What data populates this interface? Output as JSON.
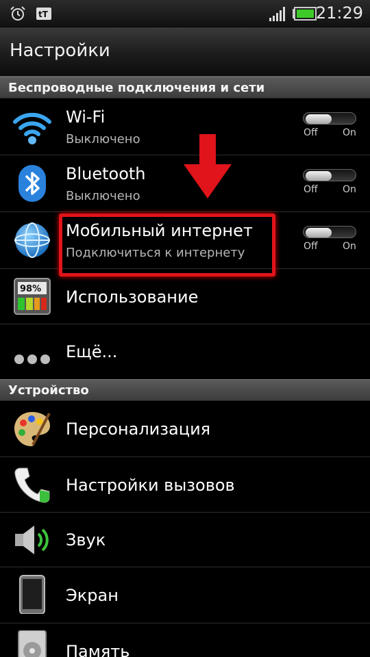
{
  "status_bar": {
    "icons": [
      "alarm-icon",
      "tt-app-icon",
      "signal-icon",
      "battery-icon"
    ],
    "time": "21:29"
  },
  "header": {
    "title": "Настройки"
  },
  "sections": [
    {
      "title": "Беспроводные подключения и сети",
      "items": [
        {
          "label": "Wi-Fi",
          "subtitle": "Выключено",
          "icon": "wifi-icon",
          "toggle": {
            "off": "Off",
            "on": "On",
            "state": "off"
          }
        },
        {
          "label": "Bluetooth",
          "subtitle": "Выключено",
          "icon": "bluetooth-icon",
          "toggle": {
            "off": "Off",
            "on": "On",
            "state": "off"
          }
        },
        {
          "label": "Мобильный интернет",
          "subtitle": "Подключиться к интернету",
          "icon": "globe-icon",
          "toggle": {
            "off": "Off",
            "on": "On",
            "state": "off"
          }
        },
        {
          "label": "Использование",
          "icon": "usage-meter-icon",
          "meter_text": "98%"
        },
        {
          "label": "Ещё...",
          "icon": "more-dots-icon"
        }
      ]
    },
    {
      "title": "Устройство",
      "items": [
        {
          "label": "Персонализация",
          "icon": "palette-icon"
        },
        {
          "label": "Настройки вызовов",
          "icon": "phone-icon"
        },
        {
          "label": "Звук",
          "icon": "speaker-icon"
        },
        {
          "label": "Экран",
          "icon": "screen-icon"
        },
        {
          "label": "Память",
          "icon": "storage-icon"
        }
      ]
    }
  ],
  "annotation": {
    "highlight_color": "#e0141a"
  }
}
